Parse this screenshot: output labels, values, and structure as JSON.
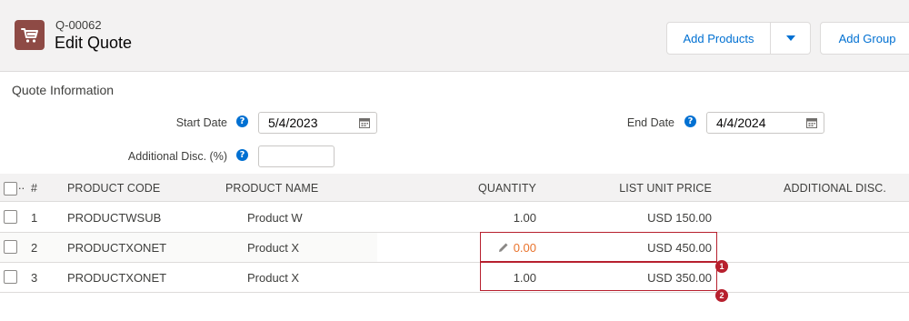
{
  "header": {
    "quote_number": "Q-00062",
    "title": "Edit Quote",
    "icon": "cart-icon",
    "add_products_label": "Add Products",
    "add_group_label": "Add Group"
  },
  "quote_info": {
    "section_title": "Quote Information",
    "start_date_label": "Start Date",
    "start_date_value": "5/4/2023",
    "end_date_label": "End Date",
    "end_date_value": "4/4/2024",
    "additional_disc_label": "Additional Disc. (%)",
    "additional_disc_value": ""
  },
  "grid": {
    "columns": {
      "select": "..",
      "index": "#",
      "product_code": "PRODUCT CODE",
      "product_name": "PRODUCT NAME",
      "quantity": "QUANTITY",
      "list_unit_price": "LIST UNIT PRICE",
      "additional_disc": "ADDITIONAL DISC."
    },
    "rows": [
      {
        "index": "1",
        "product_code": "PRODUCTWSUB",
        "product_name": "Product W",
        "quantity": "1.00",
        "list_unit_price": "USD 150.00"
      },
      {
        "index": "2",
        "product_code": "PRODUCTXONET",
        "product_name": "Product X",
        "quantity": "0.00",
        "list_unit_price": "USD 450.00"
      },
      {
        "index": "3",
        "product_code": "PRODUCTXONET",
        "product_name": "Product X",
        "quantity": "1.00",
        "list_unit_price": "USD 350.00"
      }
    ]
  },
  "annotations": {
    "badge_1": "1",
    "badge_2": "2"
  },
  "colors": {
    "accent": "#0070d2",
    "icon_bg": "#8e4a45",
    "highlight": "#b7202e",
    "edited_value": "#e9732c"
  }
}
